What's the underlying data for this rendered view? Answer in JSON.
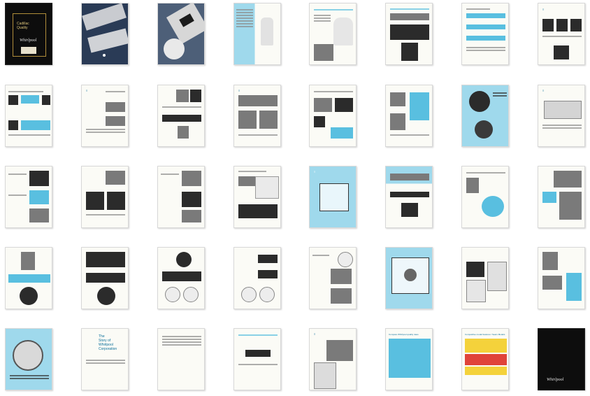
{
  "thumbnails": {
    "cover_lines": [
      "Cadillac",
      "Quality"
    ],
    "brand": "Whirlpool",
    "story_title": [
      "The",
      "Story of",
      "Whirlpool",
      "Corporation"
    ],
    "comparison_title": "Compare Whirlpool quality rates",
    "competitive_title": "Competitive model features / Sears Models",
    "back_cover_brand": "Whirlpool"
  },
  "colors": {
    "page": "#fbfbf6",
    "accent_blue": "#9fd9ec",
    "dark": "#0d0d0d",
    "gold": "#b08d3a"
  }
}
